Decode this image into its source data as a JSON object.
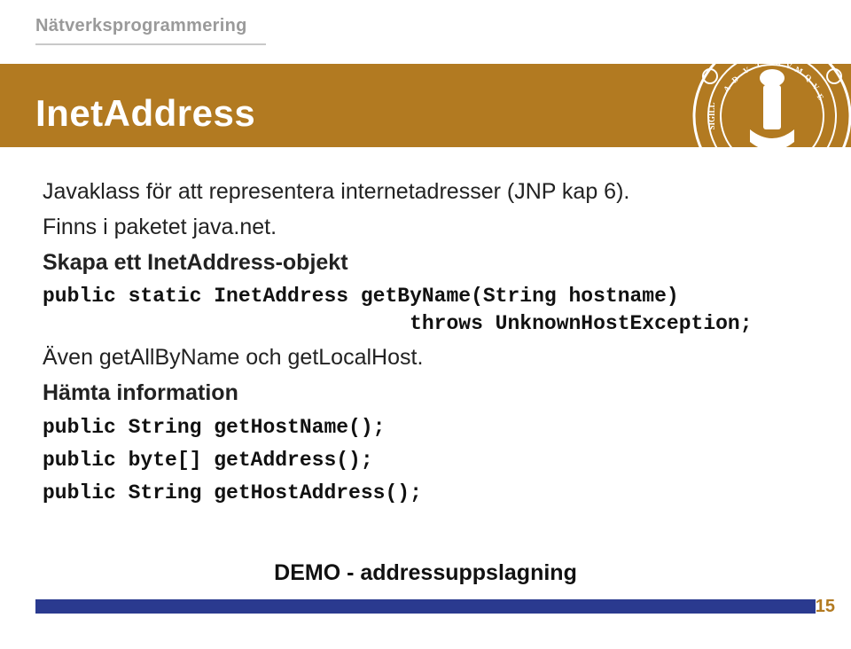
{
  "header": {
    "subtitle": "Nätverksprogrammering"
  },
  "title": "InetAddress",
  "body": {
    "line1": "Javaklass för att representera internetadresser (JNP kap 6).",
    "line2": "Finns i paketet java.net.",
    "heading1": "Skapa ett InetAddress-objekt",
    "code1": "public static InetAddress getByName(String hostname)\n                              throws UnknownHostException;",
    "line3": "Även getAllByName och getLocalHost.",
    "heading2": "Hämta information",
    "code2": "public String getHostName();",
    "code3": "public byte[] getAddress();",
    "code4": "public String getHostAddress();",
    "demo": "DEMO - addressuppslagning"
  },
  "footer": {
    "page_number": "15"
  },
  "colors": {
    "header_bg": "#b27a21",
    "footer_bar": "#2a3a8f",
    "seal_stroke": "#ffffff"
  }
}
